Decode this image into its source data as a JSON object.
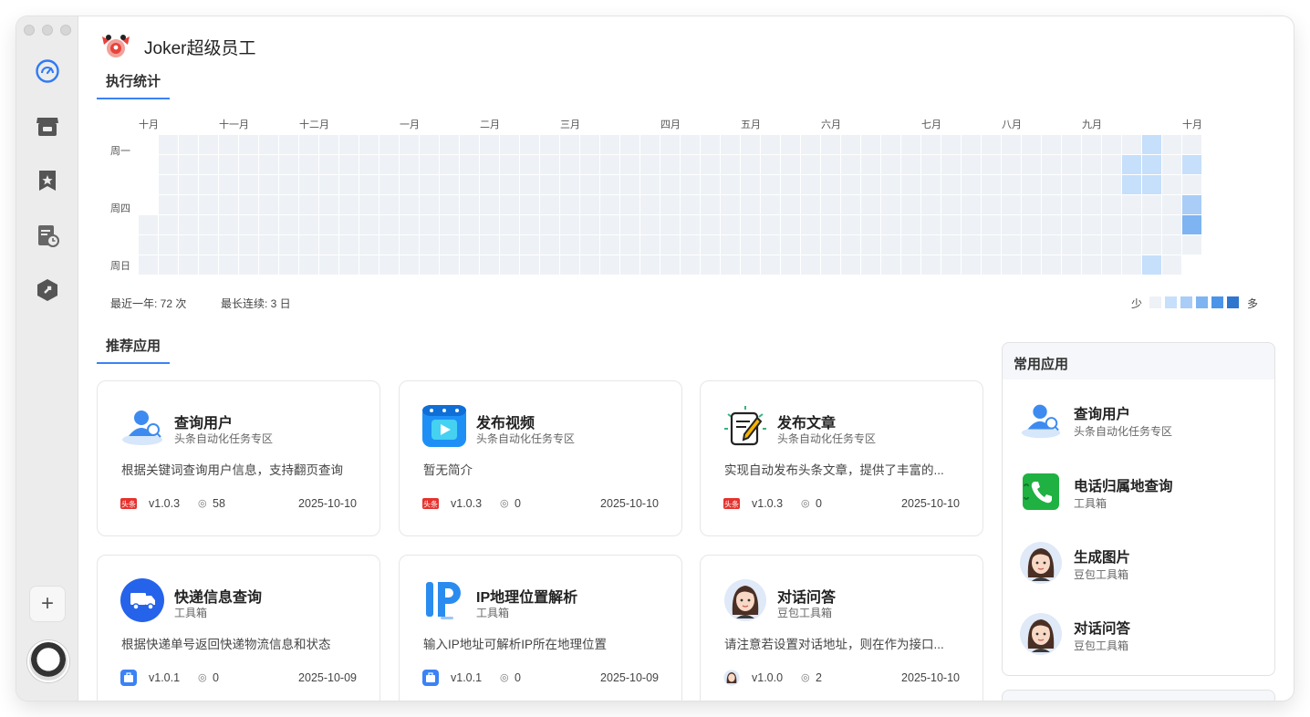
{
  "app": {
    "title": "Joker超级员工"
  },
  "sidebar": {
    "items": [
      {
        "name": "dashboard",
        "icon": "speedometer-icon",
        "active": true
      },
      {
        "name": "store",
        "icon": "store-icon"
      },
      {
        "name": "favorites",
        "icon": "bookmark-star-icon"
      },
      {
        "name": "history",
        "icon": "clock-document-icon"
      },
      {
        "name": "plugin",
        "icon": "hexagon-icon"
      }
    ],
    "add_label": "+"
  },
  "stats": {
    "tab_label": "执行统计",
    "months": [
      "十月",
      "十一月",
      "十二月",
      "一月",
      "二月",
      "三月",
      "四月",
      "五月",
      "六月",
      "七月",
      "八月",
      "九月",
      "十月"
    ],
    "weekdays": [
      "周一",
      "周四",
      "周日"
    ],
    "total_label": "最近一年: 72 次",
    "streak_label": "最长连续: 3 日",
    "legend_less": "少",
    "legend_more": "多",
    "legend_colors": [
      "#eef2f6",
      "#c6dffb",
      "#a9cdf7",
      "#7db4f1",
      "#4a94ea",
      "#2f76cf"
    ],
    "activity": [
      {
        "week": 50,
        "day": 0,
        "level": 1
      },
      {
        "week": 49,
        "day": 1,
        "level": 1
      },
      {
        "week": 50,
        "day": 1,
        "level": 1
      },
      {
        "week": 52,
        "day": 1,
        "level": 1
      },
      {
        "week": 49,
        "day": 2,
        "level": 1
      },
      {
        "week": 50,
        "day": 2,
        "level": 1
      },
      {
        "week": 52,
        "day": 3,
        "level": 2
      },
      {
        "week": 52,
        "day": 4,
        "level": 3
      },
      {
        "week": 50,
        "day": 6,
        "level": 1
      }
    ]
  },
  "recommend": {
    "tab_label": "推荐应用",
    "cards": [
      {
        "name": "查询用户",
        "category": "头条自动化任务专区",
        "desc": "根据关键词查询用户信息，支持翻页查询",
        "version": "v1.0.3",
        "views": "58",
        "date": "2025-10-10",
        "icon": "user-search-icon",
        "source": "toutiao-icon"
      },
      {
        "name": "发布视频",
        "category": "头条自动化任务专区",
        "desc": "暂无简介",
        "version": "v1.0.3",
        "views": "0",
        "date": "2025-10-10",
        "icon": "video-play-icon",
        "source": "toutiao-icon"
      },
      {
        "name": "发布文章",
        "category": "头条自动化任务专区",
        "desc": "实现自动发布头条文章，提供了丰富的...",
        "version": "v1.0.3",
        "views": "0",
        "date": "2025-10-10",
        "icon": "article-edit-icon",
        "source": "toutiao-icon"
      },
      {
        "name": "快递信息查询",
        "category": "工具箱",
        "desc": "根据快递单号返回快递物流信息和状态",
        "version": "v1.0.1",
        "views": "0",
        "date": "2025-10-09",
        "icon": "delivery-truck-icon",
        "source": "toolbox-icon"
      },
      {
        "name": "IP地理位置解析",
        "category": "工具箱",
        "desc": "输入IP地址可解析IP所在地理位置",
        "version": "v1.0.1",
        "views": "0",
        "date": "2025-10-09",
        "icon": "ip-icon",
        "source": "toolbox-icon"
      },
      {
        "name": "对话问答",
        "category": "豆包工具箱",
        "desc": "请注意若设置对话地址，则在作为接口...",
        "version": "v1.0.0",
        "views": "2",
        "date": "2025-10-10",
        "icon": "girl-avatar-icon",
        "source": "doubao-avatar-icon"
      }
    ],
    "toutiao_badge": "头条"
  },
  "favorites": {
    "title": "常用应用",
    "items": [
      {
        "name": "查询用户",
        "category": "头条自动化任务专区",
        "icon": "user-search-icon"
      },
      {
        "name": "电话归属地查询",
        "category": "工具箱",
        "icon": "phone-icon"
      },
      {
        "name": "生成图片",
        "category": "豆包工具箱",
        "icon": "girl-avatar-icon"
      },
      {
        "name": "对话问答",
        "category": "豆包工具箱",
        "icon": "girl-avatar-icon"
      }
    ]
  }
}
